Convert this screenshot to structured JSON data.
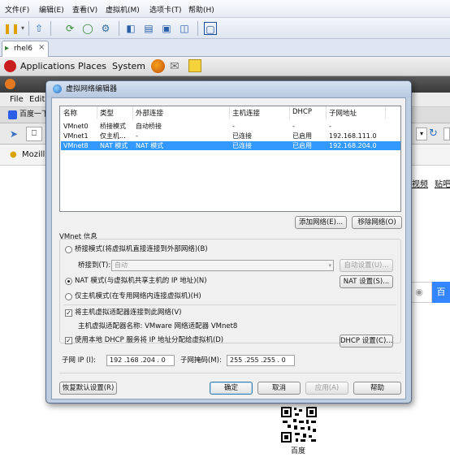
{
  "vmware": {
    "menu": [
      "文件(F)",
      "编辑(E)",
      "查看(V)",
      "虚拟机(M)",
      "选项卡(T)",
      "帮助(H)"
    ],
    "tab_label": "rhel6"
  },
  "gnome": {
    "applications": "Applications",
    "places": "Places",
    "system": "System"
  },
  "firefox": {
    "menu_file": "File",
    "menu_edit": "Edit",
    "tab_title": "百度一下",
    "bookmark": "Mozilla",
    "link_1": "视频",
    "link_2": "贴吧",
    "search_btn": "百",
    "qr_caption": "百度"
  },
  "dialog": {
    "title": "虚拟网络编辑器",
    "columns": [
      "名称",
      "类型",
      "外部连接",
      "主机连接",
      "DHCP",
      "子网地址"
    ],
    "rows": [
      {
        "name": "VMnet0",
        "type": "桥接模式",
        "external": "自动桥接",
        "host": "-",
        "dhcp": "-",
        "subnet": "-"
      },
      {
        "name": "VMnet1",
        "type": "仅主机...",
        "external": "-",
        "host": "已连接",
        "dhcp": "已启用",
        "subnet": "192.168.111.0"
      },
      {
        "name": "VMnet8",
        "type": "NAT 模式",
        "external": "NAT 模式",
        "host": "已连接",
        "dhcp": "已启用",
        "subnet": "192.168.204.0"
      }
    ],
    "add_network": "添加网络(E)...",
    "remove_network": "移除网络(O)",
    "vmnet_info": "VMnet 信息",
    "bridge_mode": "桥接模式(将虚拟机直接连接到外部网络)(B)",
    "bridge_to_label": "桥接到(T):",
    "bridge_to_value": "自动",
    "auto_settings": "自动设置(U)...",
    "nat_mode": "NAT 模式(与虚拟机共享主机的 IP 地址)(N)",
    "nat_settings": "NAT 设置(S)...",
    "host_only": "仅主机模式(在专用网络内连接虚拟机)(H)",
    "connect_adapter": "将主机虚拟适配器连接到此网络(V)",
    "adapter_name": "主机虚拟适配器名称: VMware 网络适配器 VMnet8",
    "use_dhcp": "使用本地 DHCP 服务将 IP 地址分配给虚拟机(D)",
    "dhcp_settings": "DHCP 设置(C)...",
    "subnet_ip_label": "子网 IP (I):",
    "subnet_ip": "192 .168 .204 . 0",
    "subnet_mask_label": "子网掩码(M):",
    "subnet_mask": "255 .255 .255 . 0",
    "restore_defaults": "恢复默认设置(R)",
    "ok": "确定",
    "cancel": "取消",
    "apply": "应用(A)",
    "help": "帮助"
  }
}
